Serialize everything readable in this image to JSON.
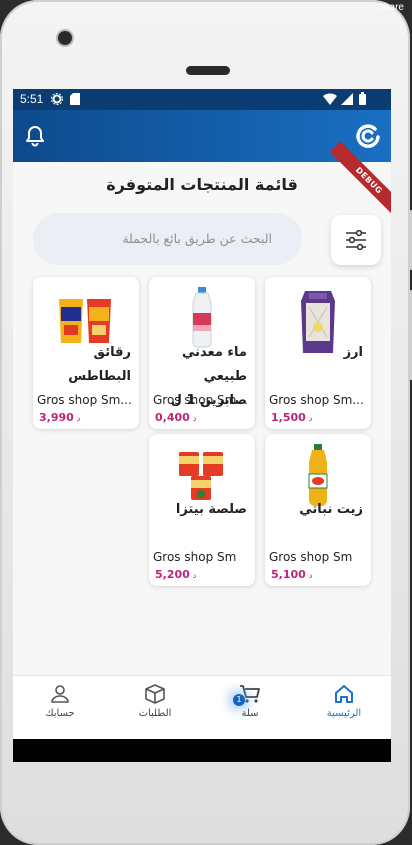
{
  "frame": {
    "share_label": "Share"
  },
  "status_bar": {
    "time": "5:51"
  },
  "app_bar": {
    "logo": "app-logo-icon",
    "notification_icon": "bell-icon"
  },
  "page": {
    "title": "قائمة المنتجات المتوفرة",
    "debug_banner": "DEBUG"
  },
  "search": {
    "placeholder": "البحث عن طريق بائع بالجملة",
    "filter_icon": "sliders-icon"
  },
  "products": [
    {
      "name": "ارز",
      "shop": "Gros shop Sm...",
      "price": "1,500",
      "currency": "د"
    },
    {
      "name": "ماء معدني طبيعي صابرين 1 ل",
      "shop": "Gros shop Sm...",
      "price": "0,400",
      "currency": "د"
    },
    {
      "name": "رقائق البطاطس",
      "shop": "Gros shop Sm...",
      "price": "3,990",
      "currency": "د"
    },
    {
      "name": "زيت نباتي",
      "shop": "Gros shop Sm",
      "price": "5,100",
      "currency": "د"
    },
    {
      "name": "صلصة بيتزا",
      "shop": "Gros shop Sm",
      "price": "5,200",
      "currency": "د"
    }
  ],
  "nav": {
    "home": "الرئيسية",
    "cart": "سلة",
    "cart_badge": "1",
    "orders": "الطلبات",
    "account": "حسابك"
  },
  "colors": {
    "app_bar": "#1a6fc2",
    "accent": "#1a73c9",
    "price": "#c0237a",
    "debug": "#b5292f"
  }
}
